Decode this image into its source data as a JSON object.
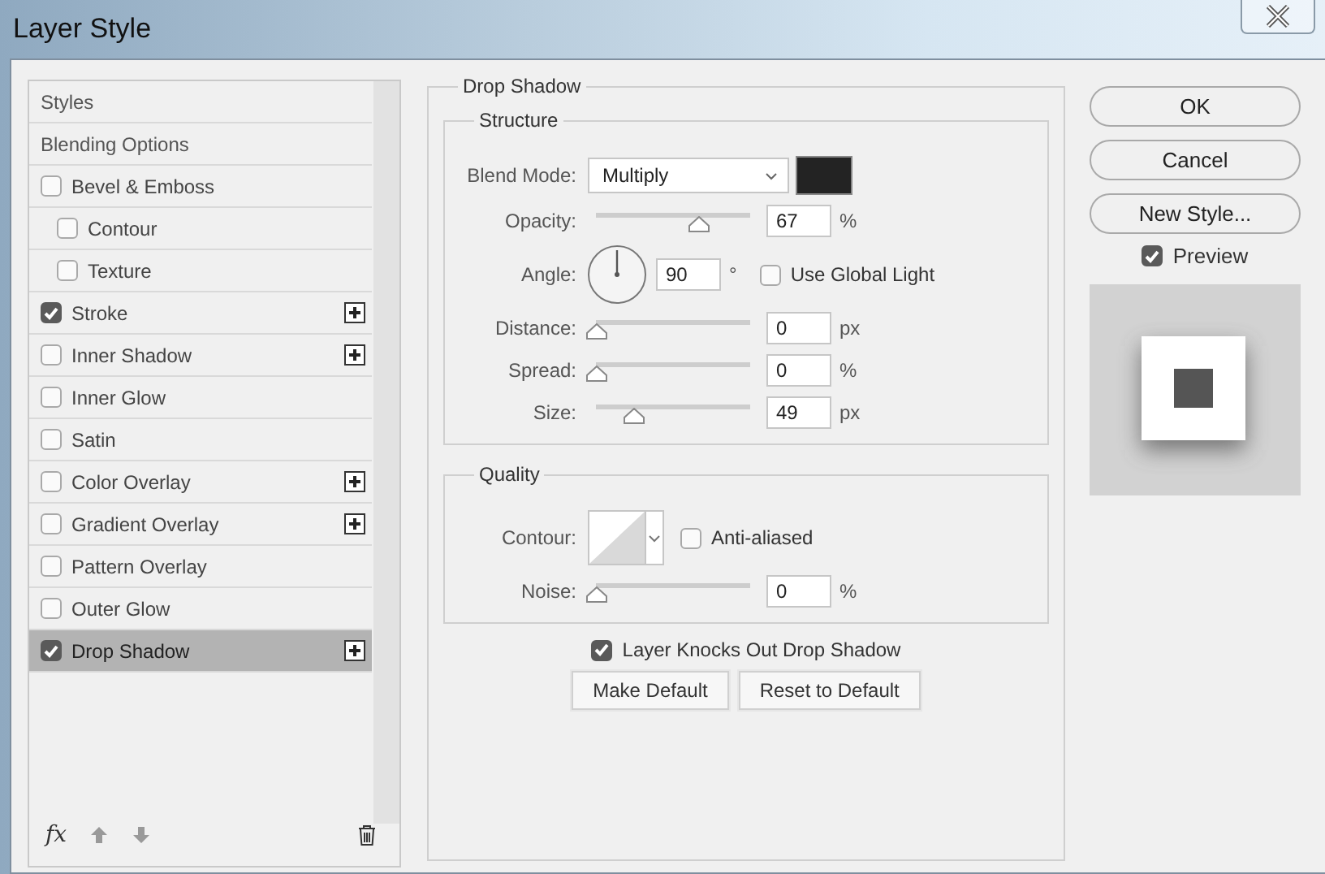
{
  "window": {
    "title": "Layer Style"
  },
  "styles_list": {
    "items": [
      {
        "kind": "header",
        "label": "Styles",
        "selected": false
      },
      {
        "kind": "header",
        "label": "Blending Options",
        "selected": false
      },
      {
        "kind": "effect",
        "label": "Bevel & Emboss",
        "checked": false,
        "selected": false,
        "addable": false,
        "children": [
          {
            "kind": "effect",
            "label": "Contour",
            "checked": false,
            "selected": false,
            "addable": false
          },
          {
            "kind": "effect",
            "label": "Texture",
            "checked": false,
            "selected": false,
            "addable": false
          }
        ]
      },
      {
        "kind": "effect",
        "label": "Stroke",
        "checked": true,
        "selected": false,
        "addable": true
      },
      {
        "kind": "effect",
        "label": "Inner Shadow",
        "checked": false,
        "selected": false,
        "addable": true
      },
      {
        "kind": "effect",
        "label": "Inner Glow",
        "checked": false,
        "selected": false,
        "addable": false
      },
      {
        "kind": "effect",
        "label": "Satin",
        "checked": false,
        "selected": false,
        "addable": false
      },
      {
        "kind": "effect",
        "label": "Color Overlay",
        "checked": false,
        "selected": false,
        "addable": true
      },
      {
        "kind": "effect",
        "label": "Gradient Overlay",
        "checked": false,
        "selected": false,
        "addable": true
      },
      {
        "kind": "effect",
        "label": "Pattern Overlay",
        "checked": false,
        "selected": false,
        "addable": false
      },
      {
        "kind": "effect",
        "label": "Outer Glow",
        "checked": false,
        "selected": false,
        "addable": false
      },
      {
        "kind": "effect",
        "label": "Drop Shadow",
        "checked": true,
        "selected": true,
        "addable": true
      }
    ],
    "fx_label": "fx"
  },
  "panel": {
    "title": "Drop Shadow",
    "structure": {
      "title": "Structure",
      "blend_mode": {
        "label": "Blend Mode:",
        "value": "Multiply",
        "color": "#232323"
      },
      "rows": [
        {
          "kind": "slider",
          "label": "Opacity:",
          "level": 0.66,
          "value": "67",
          "unit": "%"
        },
        {
          "kind": "angle",
          "label": "Angle:",
          "value": "90",
          "unit": "°",
          "checkbox": {
            "label": "Use Global Light",
            "checked": false
          }
        },
        {
          "kind": "slider",
          "label": "Distance:",
          "level": 0,
          "value": "0",
          "unit": "px"
        },
        {
          "kind": "slider",
          "label": "Spread:",
          "level": 0,
          "value": "0",
          "unit": "%"
        },
        {
          "kind": "slider",
          "label": "Size:",
          "level": 0.24,
          "value": "49",
          "unit": "px"
        }
      ]
    },
    "quality": {
      "title": "Quality",
      "contour": {
        "label": "Contour:",
        "checkbox": {
          "label": "Anti-aliased",
          "checked": false
        }
      },
      "rows": [
        {
          "kind": "slider",
          "label": "Noise:",
          "level": 0,
          "value": "0",
          "unit": "%"
        }
      ]
    },
    "knockout": {
      "label": "Layer Knocks Out Drop Shadow",
      "checked": true
    },
    "buttons": [
      "Make Default",
      "Reset to Default"
    ]
  },
  "actions": {
    "buttons": [
      "OK",
      "Cancel",
      "New Style..."
    ],
    "preview": {
      "label": "Preview",
      "checked": true
    }
  }
}
